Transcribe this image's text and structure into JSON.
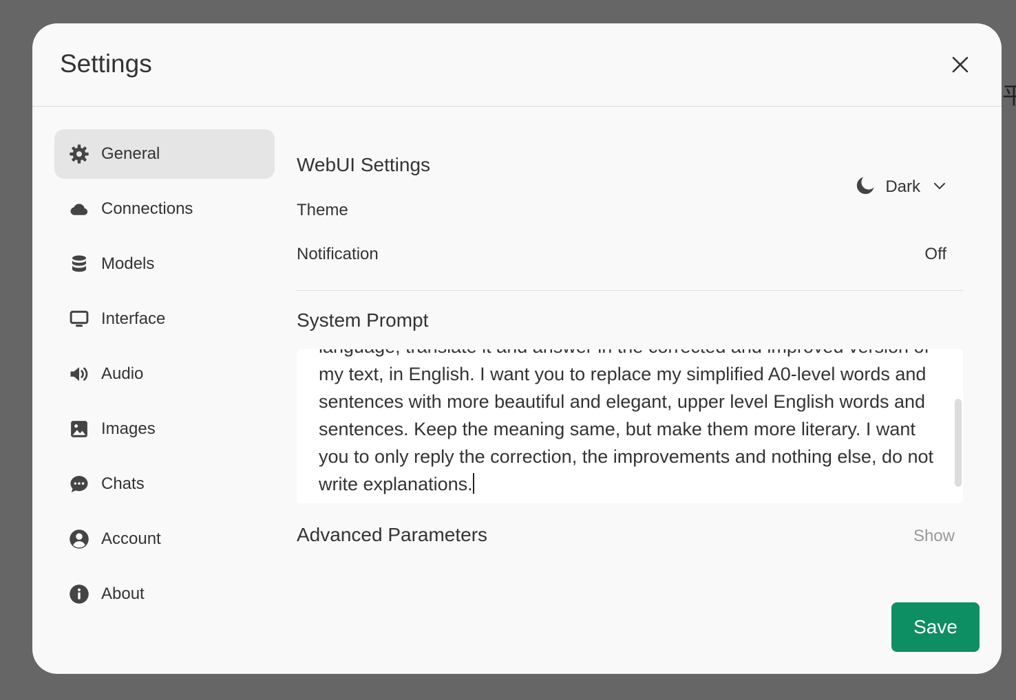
{
  "backdrop": {
    "edge_glyph": "平"
  },
  "dialog": {
    "title": "Settings",
    "close_label": "close"
  },
  "sidebar": {
    "items": [
      {
        "label": "General",
        "icon": "gear-icon",
        "active": true
      },
      {
        "label": "Connections",
        "icon": "cloud-icon",
        "active": false
      },
      {
        "label": "Models",
        "icon": "database-icon",
        "active": false
      },
      {
        "label": "Interface",
        "icon": "monitor-icon",
        "active": false
      },
      {
        "label": "Audio",
        "icon": "speaker-icon",
        "active": false
      },
      {
        "label": "Images",
        "icon": "image-icon",
        "active": false
      },
      {
        "label": "Chats",
        "icon": "chat-bubble-icon",
        "active": false
      },
      {
        "label": "Account",
        "icon": "user-circle-icon",
        "active": false
      },
      {
        "label": "About",
        "icon": "info-icon",
        "active": false
      }
    ]
  },
  "general": {
    "webui_title": "WebUI Settings",
    "theme_label": "Theme",
    "theme_value": "Dark",
    "notification_label": "Notification",
    "notification_value": "Off",
    "system_prompt_title": "System Prompt",
    "system_prompt_text": "language, translate it and answer in the corrected and improved version of my text, in English. I want you to replace my simplified A0-level words and sentences with more beautiful and elegant, upper level English words and sentences. Keep the meaning same, but make them more literary. I want you to only reply the correction, the improvements and nothing else, do not write explanations.",
    "advanced_title": "Advanced Parameters",
    "advanced_toggle": "Show"
  },
  "footer": {
    "save_label": "Save"
  },
  "colors": {
    "backdrop": "#666666",
    "dialog_bg": "#f9f9f9",
    "active_item_bg": "#e5e5e5",
    "save_button": "#0d8f63"
  }
}
